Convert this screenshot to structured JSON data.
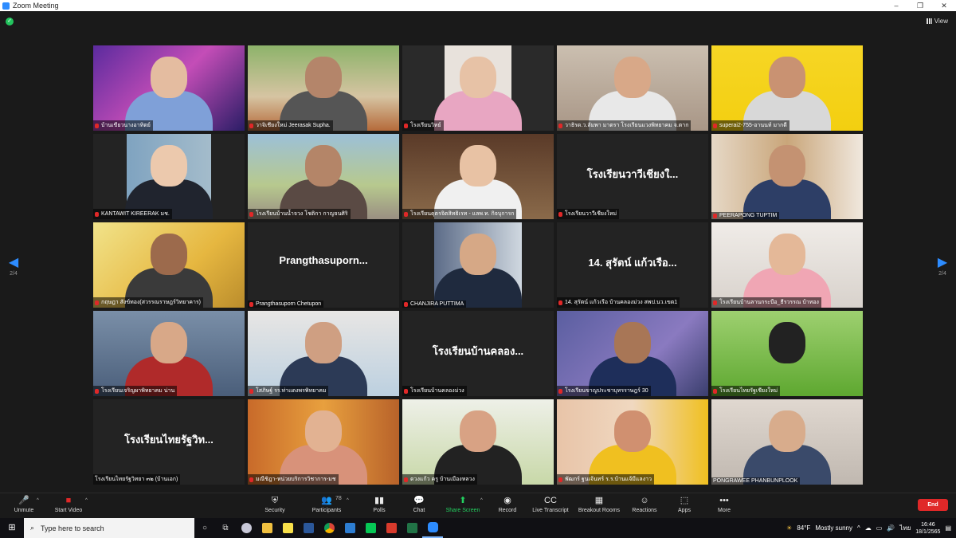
{
  "window": {
    "title": "Zoom Meeting",
    "controls": [
      "–",
      "❐",
      "✕"
    ]
  },
  "header": {
    "view_label": "View"
  },
  "pager": {
    "left": "2/4",
    "right": "2/4"
  },
  "colors": {
    "accent": "#2d8cff",
    "end": "#e02828",
    "share": "#23d160",
    "muted": "#e02828"
  },
  "tiles": [
    {
      "name": "บ้านเขียวนางอาทิตย์",
      "muted": true,
      "bg": "linear-gradient(135deg,#5b2b9e,#c44db7 50%,#2a1d66)",
      "skin": "#e4bca0",
      "shirt": "#7fa0d8"
    },
    {
      "name": "วาจิเชียงใหม่ Jeerasak Supha.",
      "muted": true,
      "bg": "linear-gradient(180deg,#8db36a,#d6c4a2 60%,#b56a3a)",
      "skin": "#b4856a",
      "shirt": "#555"
    },
    {
      "name": "โรงเรียนวิทย์",
      "muted": true,
      "bg": "linear-gradient(90deg,#2a2a2a 28%,#e8e2dc 28%,#e8e2dc 72%,#2a2a2a 72%)",
      "skin": "#e7c2a6",
      "shirt": "#e8a6c2"
    },
    {
      "name": "วาธิรด.ว.ลัมพา มาตรา โรงเรียนแวงพิทยาคม จ.ตาก",
      "muted": true,
      "bg": "linear-gradient(180deg,#cbbfb0,#a89686)",
      "skin": "#d8a888",
      "shirt": "#e8e8e8"
    },
    {
      "name": "superai2-755-อานนท์ มากดี",
      "muted": true,
      "bg": "linear-gradient(180deg,#f6d625,#f3cf10)",
      "skin": "#c99272",
      "shirt": "#d8d8d8"
    },
    {
      "name": "KANTAWIT KIREERAK มช.",
      "muted": true,
      "bg": "linear-gradient(90deg,#232323 22%,#7fa3c0 22%,#a4bccb 78%,#232323 78%)",
      "skin": "#ecc9ad",
      "shirt": "#20242e"
    },
    {
      "name": "โรงเรียนบ้านน้ำจวง โชติกา กาญจนศิริ",
      "muted": true,
      "bg": "linear-gradient(180deg,#9cc0d8,#b7c98e 60%,#9a8f82)",
      "skin": "#b48568",
      "shirt": "#5a4a44"
    },
    {
      "name": "โรงเรียนดุตรจิตสิทธิเรท - แลพ.ท. กิจบุการก",
      "muted": true,
      "bg": "linear-gradient(180deg,#5a3a28,#8a6a4a)",
      "skin": "#e8c2a4",
      "shirt": "#f0f0f0"
    },
    {
      "name": "โรงเรียนวาวีเชียงใหม่",
      "muted": true,
      "big": "โรงเรียนวาวีเชียงใ...",
      "bg": "#232323"
    },
    {
      "name": "PEERAPONG TUPTIM",
      "muted": true,
      "bg": "linear-gradient(90deg,#e6d8c6,#c9a67a 50%,#f0e8de)",
      "skin": "#c49272",
      "shirt": "#2d3e66"
    },
    {
      "name": "กฤษฎา สังข์ทอง(สวรรณราษฎร์วิทยาคาร)",
      "muted": true,
      "bg": "linear-gradient(135deg,#f1e38a,#e6b740 60%,#bb8d2c)",
      "skin": "#9c6a4c",
      "shirt": "#3a3a3a"
    },
    {
      "name": "Prangthasuporn Chetupon",
      "muted": true,
      "big": "Prangthasuporn...",
      "bg": "#232323"
    },
    {
      "name": "CHANJIRA PUTTIMA",
      "muted": true,
      "bg": "linear-gradient(90deg,#232323 21%,#5c6c88 21%,#d0d8e0 79%,#232323 79%)",
      "skin": "#d6a886",
      "shirt": "#1f2a3e"
    },
    {
      "name": "14. สุรัตน์ แก้วเรือ บ้านคลองม่วง สพป.นว.เขต1",
      "muted": true,
      "big": "14. สุรัตน์ แก้วเรือ...",
      "bg": "#232323"
    },
    {
      "name": "โรงเรียนบ้านลานกระบือ_ธีรวรรณ บ้าทอง",
      "muted": true,
      "bg": "linear-gradient(180deg,#f0ece8,#d8d2cc)",
      "skin": "#e4b898",
      "shirt": "#f0a6b4"
    },
    {
      "name": "โรงเรียนเจริญผาพิทยาคม น่าน",
      "muted": true,
      "bg": "linear-gradient(180deg,#7a8fa8,#4a5e7a)",
      "skin": "#d8a888",
      "shirt": "#b02a2a"
    },
    {
      "name": "โสภิษฐ์ รร.ท่าแดงพรพิทยาคม",
      "muted": true,
      "bg": "linear-gradient(180deg,#e8e6e4,#bcd0e0)",
      "skin": "#cf9f82",
      "shirt": "#2c3a56"
    },
    {
      "name": "โรงเรียนบ้านคลองม่วง",
      "muted": true,
      "big": "โรงเรียนบ้านคลอง...",
      "bg": "#232323"
    },
    {
      "name": "โรงเรียนขาญประชาบุทรราษฎร์ 30",
      "muted": true,
      "bg": "linear-gradient(135deg,#5a5ea0,#8a7ac0 60%,#3a3e6e)",
      "skin": "#a87656",
      "shirt": "#1e2e5a"
    },
    {
      "name": "โรงเรียนไทยรัฐเชียงใหม่",
      "muted": true,
      "bg": "linear-gradient(180deg,#9ed070,#5ea830)",
      "skin": "#222",
      "shirt": "transparent"
    },
    {
      "name": "โรงเรียนไทยรัฐวิทยา ๓๒ (บ้านเอก)",
      "muted": false,
      "big": "โรงเรียนไทยรัฐวิท...",
      "bg": "#232323"
    },
    {
      "name": "มณีชิฎา-หน่วยบริการวิชาการ-มช",
      "muted": true,
      "bg": "linear-gradient(90deg,#c86a2a,#e8a03e 50%,#b8622a)",
      "skin": "#e2b292",
      "shirt": "#d8927a"
    },
    {
      "name": "ดวงแก้ว ครู บ้านเมืองหลวง",
      "muted": true,
      "bg": "linear-gradient(180deg,#eef0e8,#c8d8a8)",
      "skin": "#d8a284",
      "shirt": "#222"
    },
    {
      "name": "พัฒกร์ ฐนเจ้นทร์ ร.ร.บ้านแจ้มีแลงาว",
      "muted": true,
      "bg": "linear-gradient(90deg,#e8c4a8,#f0d8c0 50%,#f0c020)",
      "skin": "#d09070",
      "shirt": "#f0c020"
    },
    {
      "name": "PONGRAWEE PHANBUNPLOOK",
      "muted": false,
      "bg": "linear-gradient(180deg,#e0d8d0,#c0b8b0)",
      "skin": "#d8ac8c",
      "shirt": "#3a4a6a"
    }
  ],
  "toolbar": {
    "unmute": "Unmute",
    "start_video": "Start Video",
    "security": "Security",
    "participants": "Participants",
    "participants_count": "78",
    "polls": "Polls",
    "chat": "Chat",
    "share_screen": "Share Screen",
    "record": "Record",
    "live_transcript": "Live Transcript",
    "breakout_rooms": "Breakout Rooms",
    "reactions": "Reactions",
    "apps": "Apps",
    "more": "More",
    "end": "End"
  },
  "taskbar": {
    "search_placeholder": "Type here to search",
    "weather_temp": "84°F",
    "weather_text": "Mostly sunny",
    "lang": "ไทย",
    "time": "16:46",
    "date": "18/1/2565"
  }
}
